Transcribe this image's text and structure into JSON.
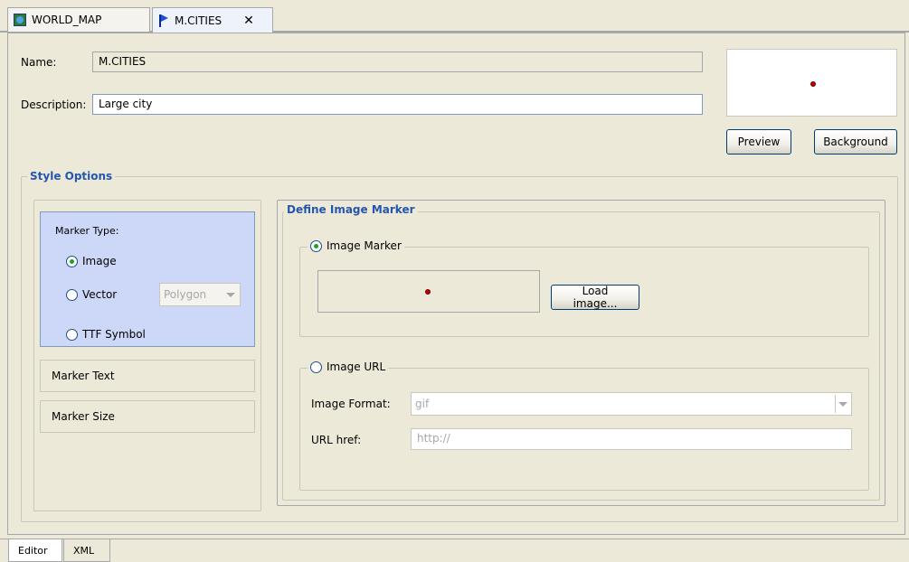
{
  "tabs": [
    {
      "label": "WORLD_MAP",
      "icon": "globe-icon",
      "active": false
    },
    {
      "label": "M.CITIES",
      "icon": "flag-icon",
      "active": true
    }
  ],
  "form": {
    "name_label": "Name:",
    "name_value": "M.CITIES",
    "description_label": "Description:",
    "description_value": "Large city"
  },
  "preview": {
    "preview_button": "Preview",
    "background_button": "Background"
  },
  "style_options": {
    "title": "Style Options",
    "marker_type_label": "Marker Type:",
    "options": {
      "image": "Image",
      "vector": "Vector",
      "ttf": "TTF Symbol"
    },
    "vector_shape": "Polygon",
    "marker_text": "Marker Text",
    "marker_size": "Marker Size"
  },
  "image_marker": {
    "title": "Define Image Marker",
    "image_marker_label": "Image Marker",
    "load_button": "Load image...",
    "image_url_label": "Image URL",
    "format_label": "Image Format:",
    "format_value": "gif",
    "href_label": "URL href:",
    "href_value": "http://"
  },
  "bottom_tabs": [
    {
      "label": "Editor",
      "active": true
    },
    {
      "label": "XML",
      "active": false
    }
  ],
  "colors": {
    "accent_text": "#2456b0",
    "marker_fill": "#c00000",
    "selected_panel": "#cdd8f8"
  }
}
